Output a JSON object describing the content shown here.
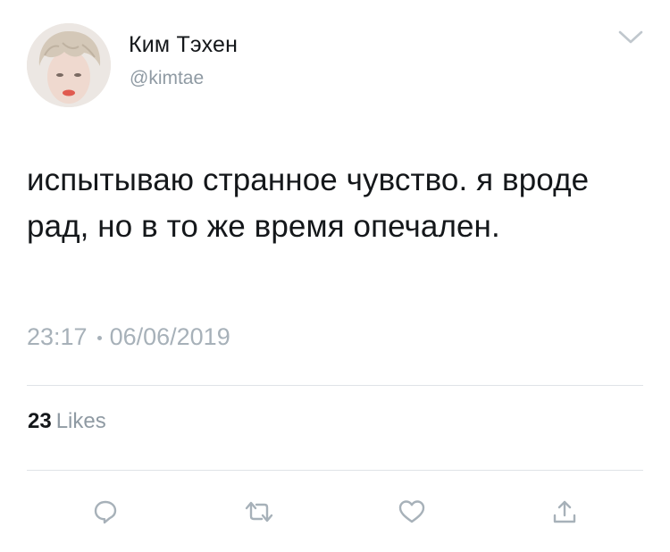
{
  "author": {
    "display_name": "Ким Тэхен",
    "handle": "@kimtae"
  },
  "tweet": {
    "text": "испытываю странное чувство. я вроде рад, но в то же время опечален.",
    "time": "23:17",
    "date": "06/06/2019"
  },
  "stats": {
    "likes_count": "23",
    "likes_label": "Likes"
  },
  "icons": {
    "menu": "chevron-down-icon",
    "reply": "reply-icon",
    "retweet": "retweet-icon",
    "like": "heart-icon",
    "share": "share-icon"
  },
  "colors": {
    "text_primary": "#14171a",
    "text_secondary": "#8f9aa3",
    "icon_gray": "#a7b1b9",
    "divider": "#dfe3e7",
    "background": "#ffffff"
  }
}
